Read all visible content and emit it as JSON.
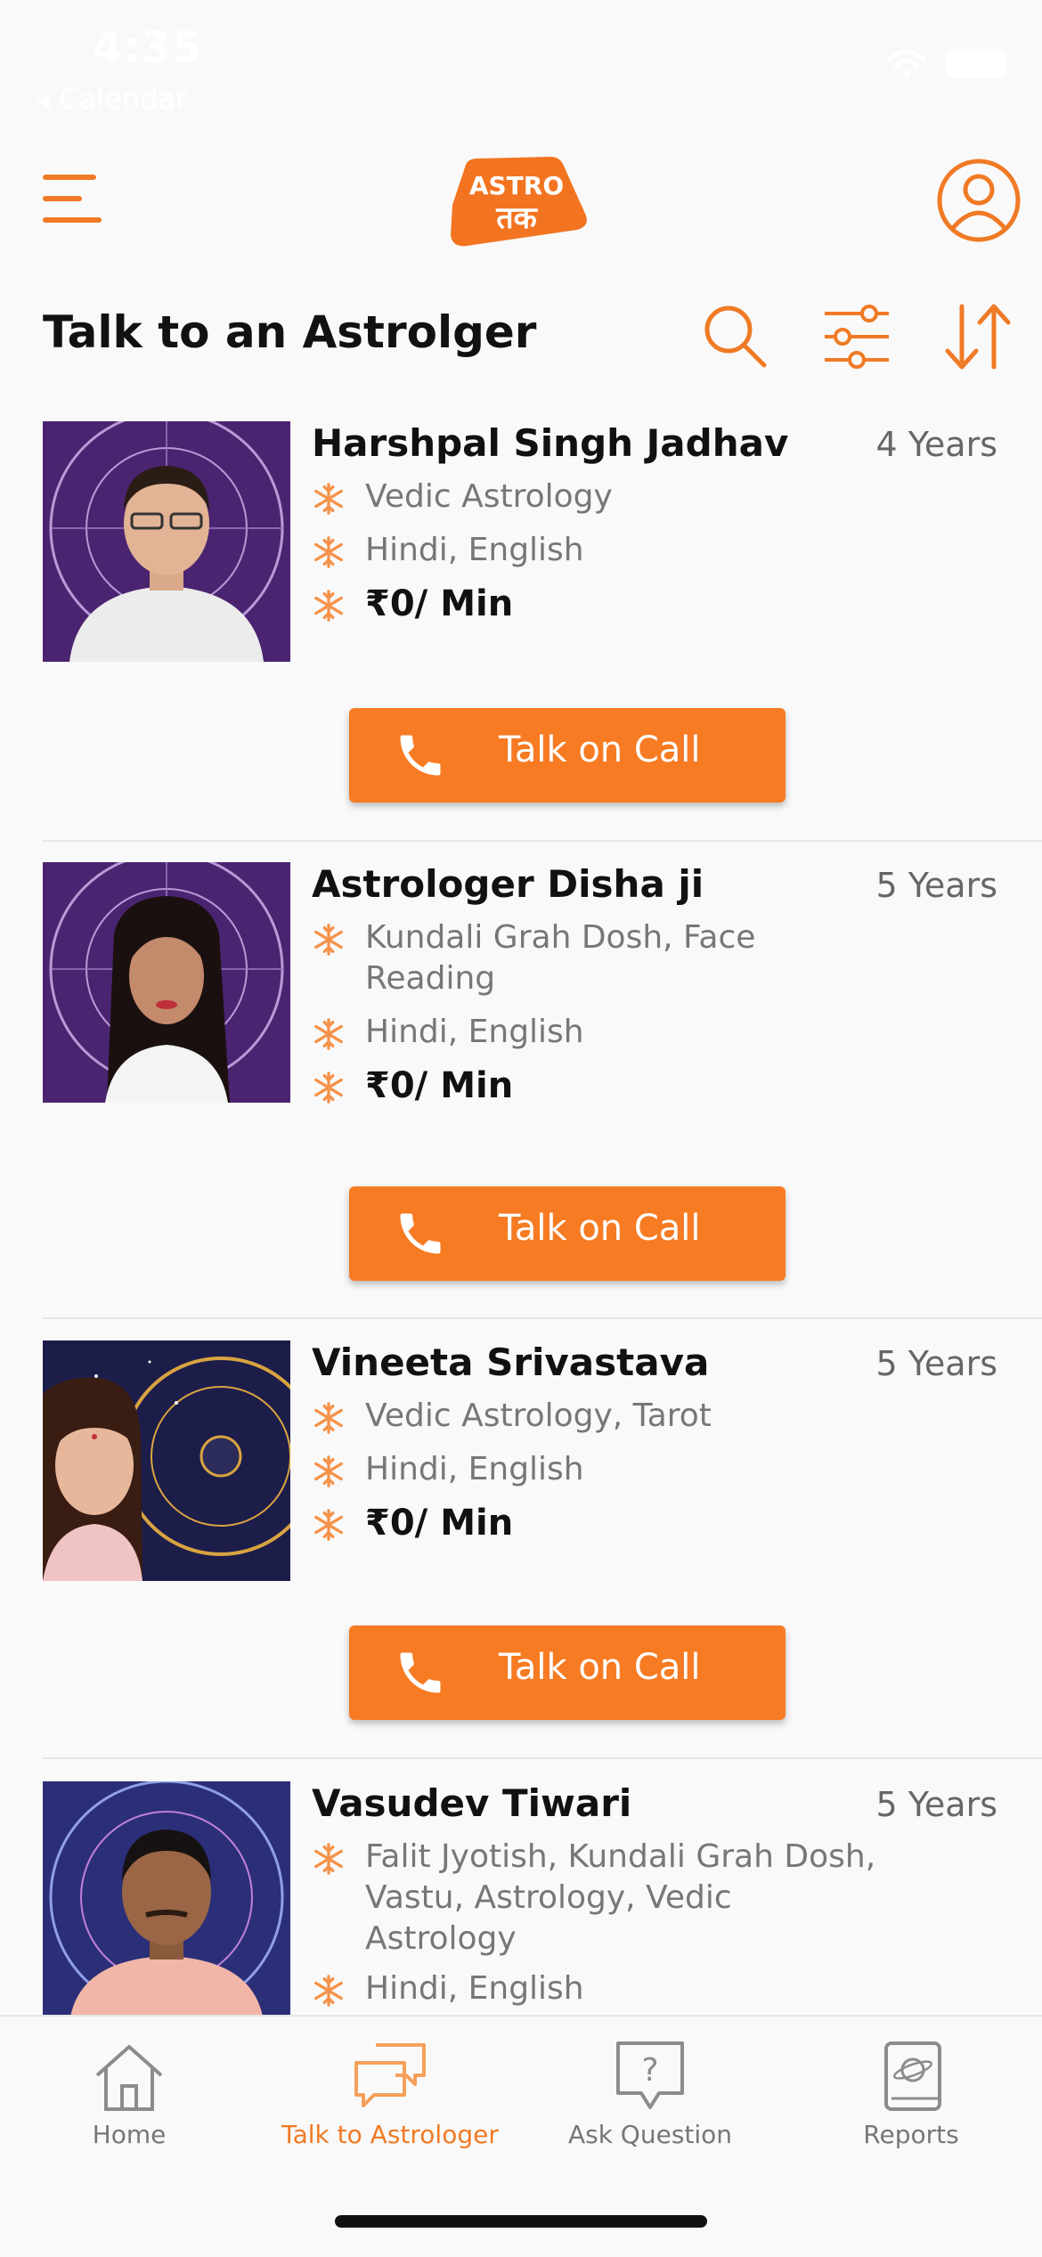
{
  "status_bar": {
    "time": "4:35",
    "back_label": "◂ Calendar"
  },
  "header": {
    "menu_icon": "hamburger-icon",
    "logo": {
      "line1": "ASTRO",
      "line2": "तक"
    },
    "profile_icon": "user-circle-icon",
    "accent_color": "#f07a25"
  },
  "toolbar": {
    "title": "Talk to an Astrolger",
    "icons": [
      "search-icon",
      "filter-sliders-icon",
      "sort-icon"
    ]
  },
  "astrologers": [
    {
      "name": "Harshpal Singh Jadhav",
      "experience": "4 Years",
      "skills": "Vedic Astrology",
      "languages": "Hindi, English",
      "price": "₹0/ Min",
      "cta": "Talk on Call"
    },
    {
      "name": "Astrologer Disha ji",
      "experience": "5 Years",
      "skills": "Kundali Grah Dosh, Face Reading",
      "languages": "Hindi, English",
      "price": "₹0/ Min",
      "cta": "Talk on Call"
    },
    {
      "name": "Vineeta Srivastava",
      "experience": "5 Years",
      "skills": "Vedic Astrology, Tarot",
      "languages": "Hindi, English",
      "price": "₹0/ Min",
      "cta": "Talk on Call"
    },
    {
      "name": "Vasudev Tiwari",
      "experience": "5 Years",
      "skills": "Falit Jyotish, Kundali Grah Dosh, Vastu, Astrology, Vedic Astrology",
      "languages": "Hindi, English"
    }
  ],
  "bottom_nav": {
    "items": [
      {
        "label": "Home",
        "icon": "home-icon"
      },
      {
        "label": "Talk to Astrologer",
        "icon": "chat-bubbles-icon",
        "active": true
      },
      {
        "label": "Ask Question",
        "icon": "question-bubble-icon"
      },
      {
        "label": "Reports",
        "icon": "report-book-icon"
      }
    ]
  }
}
